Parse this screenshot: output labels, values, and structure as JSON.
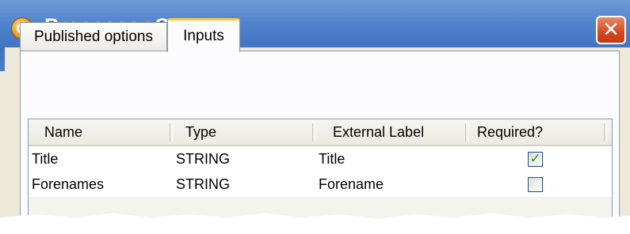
{
  "window": {
    "title": "Processor Setup",
    "close_symbol": "✕",
    "icon": "processor-app-icon"
  },
  "tabs": [
    {
      "label": "Published options",
      "active": false
    },
    {
      "label": "Inputs",
      "active": true
    }
  ],
  "grid": {
    "columns": [
      "Name",
      "Type",
      "External Label",
      "Required?"
    ],
    "rows": [
      {
        "name": "Title",
        "type": "STRING",
        "external_label": "Title",
        "required": true,
        "check_symbol": "✓"
      },
      {
        "name": "Forenames",
        "type": "STRING",
        "external_label": "Forename",
        "required": false,
        "check_symbol": ""
      }
    ]
  },
  "colors": {
    "titlebar": "#4f82cc",
    "active_tab_accent": "#ffc83c",
    "close_button": "#d4471f",
    "check": "#21a121"
  }
}
